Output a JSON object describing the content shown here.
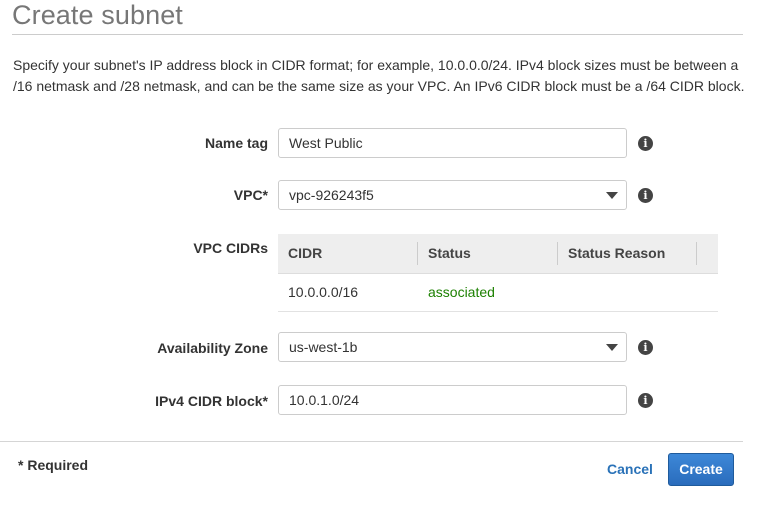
{
  "page": {
    "title": "Create subnet",
    "description": "Specify your subnet's IP address block in CIDR format; for example, 10.0.0.0/24. IPv4 block sizes must be between a /16 netmask and /28 netmask, and can be the same size as your VPC. An IPv6 CIDR block must be a /64 CIDR block."
  },
  "form": {
    "name_tag": {
      "label": "Name tag",
      "value": "West Public"
    },
    "vpc": {
      "label": "VPC*",
      "value": "vpc-926243f5"
    },
    "vpc_cidrs": {
      "label": "VPC CIDRs",
      "columns": [
        "CIDR",
        "Status",
        "Status Reason"
      ],
      "rows": [
        {
          "cidr": "10.0.0.0/16",
          "status": "associated",
          "status_reason": ""
        }
      ]
    },
    "availability_zone": {
      "label": "Availability Zone",
      "value": "us-west-1b"
    },
    "ipv4_cidr": {
      "label": "IPv4 CIDR block*",
      "value": "10.0.1.0/24"
    }
  },
  "footer": {
    "required_note": "* Required",
    "cancel_label": "Cancel",
    "create_label": "Create"
  },
  "icons": {
    "info": "info-circle-icon",
    "dropdown": "caret-down-icon"
  },
  "colors": {
    "accent": "#2a72b8",
    "status_ok": "#1d8102",
    "button_primary": "#2a6cbc"
  }
}
